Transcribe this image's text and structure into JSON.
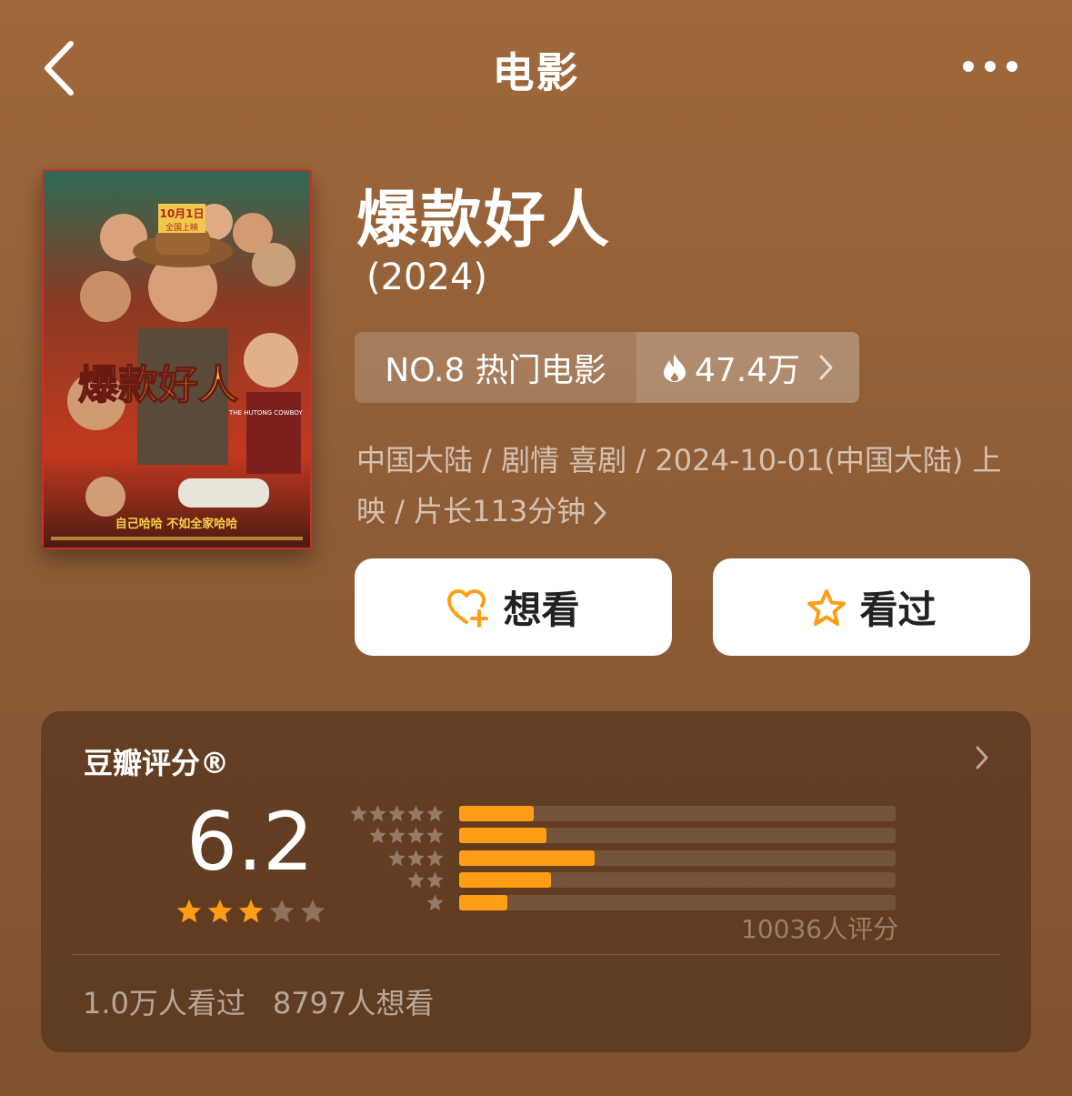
{
  "header": {
    "title": "电影"
  },
  "movie": {
    "title": "爆款好人",
    "year": "(2024)",
    "rank_label": "NO.8 热门电影",
    "hot_count": "47.4万",
    "meta": "中国大陆 / 剧情 喜剧 / 2024-10-01(中国大陆) 上映 / 片长113分钟",
    "poster": {
      "date": "10月1日",
      "release": "全国上映",
      "title": "爆款好人",
      "english_title": "THE HUTONG COWBOY",
      "slogan": "自己哈哈 不如全家哈哈"
    }
  },
  "actions": {
    "want_label": "想看",
    "seen_label": "看过"
  },
  "rating": {
    "label": "豆瓣评分®",
    "score": "6.2",
    "stars": 3,
    "distribution": [
      {
        "stars": 5,
        "fraction": 0.17
      },
      {
        "stars": 4,
        "fraction": 0.2
      },
      {
        "stars": 3,
        "fraction": 0.31
      },
      {
        "stars": 2,
        "fraction": 0.21
      },
      {
        "stars": 1,
        "fraction": 0.11
      }
    ],
    "count": "10036人评分",
    "seen": "1.0万人看过",
    "want": "8797人想看"
  },
  "colors": {
    "accent": "#ff9e16",
    "background": "#9a6539"
  }
}
